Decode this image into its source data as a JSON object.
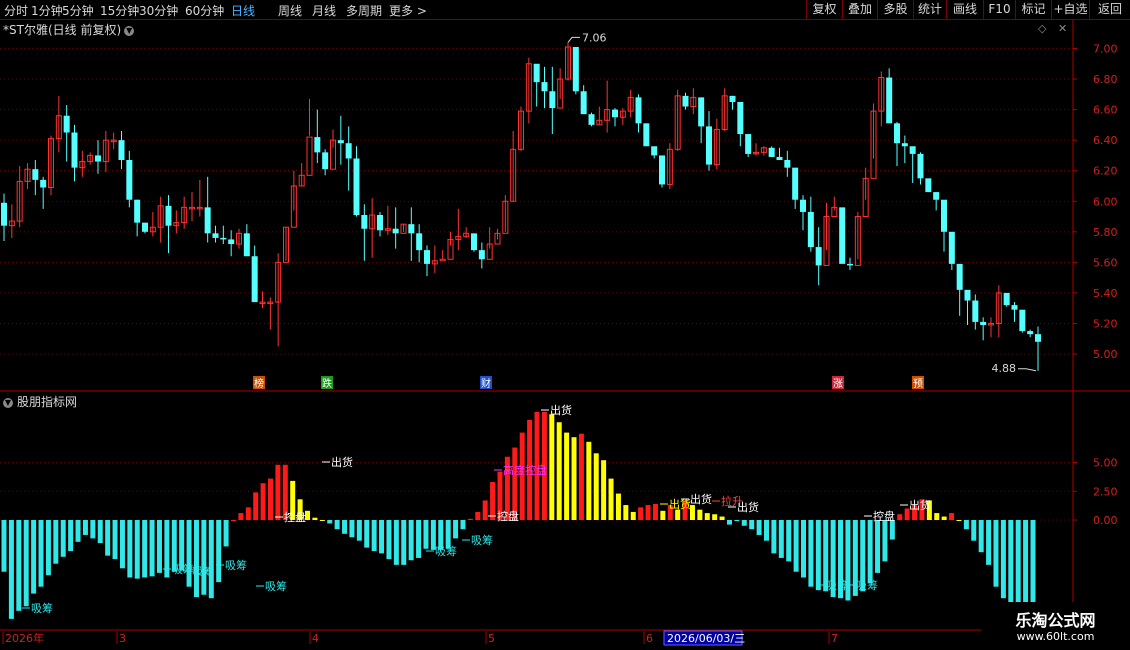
{
  "toolbar": {
    "periods": [
      {
        "label": "分时",
        "active": false
      },
      {
        "label": "1分钟",
        "active": false
      },
      {
        "label": "5分钟",
        "active": false
      },
      {
        "label": "15分钟",
        "active": false
      },
      {
        "label": "30分钟",
        "active": false
      },
      {
        "label": "60分钟",
        "active": false
      },
      {
        "label": "日线",
        "active": true
      },
      {
        "label": "周线",
        "active": false
      },
      {
        "label": "月线",
        "active": false
      },
      {
        "label": "多周期",
        "active": false
      },
      {
        "label": "更多 >",
        "active": false
      }
    ],
    "buttons": [
      "复权",
      "叠加",
      "多股",
      "统计",
      "画线",
      "F10",
      "标记",
      "+自选",
      "返回"
    ]
  },
  "main_chart": {
    "title": "*ST尔雅(日线 前复权)",
    "collapse_icon": "chevron-down-icon",
    "top_right_icons": [
      "diamond-icon",
      "close-icon"
    ],
    "high_label": "7.06",
    "low_label": "4.88",
    "event_markers": [
      {
        "text": "榜",
        "color": "#c85000"
      },
      {
        "text": "跌",
        "color": "#1a9a1a"
      },
      {
        "text": "财",
        "color": "#2050c8"
      },
      {
        "text": "涨",
        "color": "#c8283c"
      },
      {
        "text": "预",
        "color": "#c85000"
      }
    ]
  },
  "indicator": {
    "title": "股朋指标网",
    "collapse_icon": "chevron-down-icon",
    "labels": [
      "吸筹",
      "吸筹",
      "吸筹",
      "吸筹",
      "吸筹",
      "控盘",
      "出货",
      "吸筹",
      "吸筹",
      "控盘",
      "高度控盘",
      "出货",
      "出货",
      "出货",
      "拉升",
      "出货",
      "吸筹",
      "吸筹",
      "控盘",
      "出货"
    ]
  },
  "date_axis": {
    "labels": [
      "2026年",
      "3",
      "4",
      "5",
      "6",
      "7"
    ],
    "cursor_date": "2026/06/03/三"
  },
  "watermark": {
    "name": "乐淘公式网",
    "url": "www.60lt.com"
  },
  "chart_data": [
    {
      "type": "candlestick",
      "title": "*ST尔雅(日线 前复权)",
      "ylim": [
        4.85,
        7.15
      ],
      "yticks": [
        "7.00",
        "6.80",
        "6.60",
        "6.40",
        "6.20",
        "6.00",
        "5.80",
        "5.60",
        "5.40",
        "5.20",
        "5.00"
      ],
      "grid": true,
      "colors": {
        "up": "#ff3232",
        "down": "#54ffff"
      },
      "candles": [
        [
          5.99,
          5.84,
          6.05,
          5.74
        ],
        [
          5.84,
          5.87,
          5.98,
          5.76
        ],
        [
          5.87,
          6.13,
          6.23,
          5.83
        ],
        [
          6.13,
          6.21,
          6.25,
          6.08
        ],
        [
          6.21,
          6.14,
          6.27,
          6.04
        ],
        [
          6.14,
          6.09,
          6.16,
          5.95
        ],
        [
          6.09,
          6.41,
          6.43,
          6.04
        ],
        [
          6.41,
          6.56,
          6.69,
          6.32
        ],
        [
          6.56,
          6.45,
          6.63,
          6.26
        ],
        [
          6.45,
          6.22,
          6.5,
          6.13
        ],
        [
          6.22,
          6.26,
          6.33,
          6.16
        ],
        [
          6.26,
          6.3,
          6.32,
          6.24
        ],
        [
          6.3,
          6.26,
          6.4,
          6.18
        ],
        [
          6.26,
          6.4,
          6.46,
          6.19
        ],
        [
          6.4,
          6.4,
          6.45,
          6.34
        ],
        [
          6.4,
          6.27,
          6.46,
          6.21
        ],
        [
          6.27,
          6.01,
          6.33,
          5.96
        ],
        [
          6.01,
          5.86,
          6.01,
          5.77
        ],
        [
          5.86,
          5.8,
          5.84,
          5.79
        ],
        [
          5.8,
          5.83,
          5.93,
          5.77
        ],
        [
          5.83,
          5.97,
          6.03,
          5.73
        ],
        [
          5.97,
          5.84,
          6.04,
          5.66
        ],
        [
          5.84,
          5.86,
          5.94,
          5.79
        ],
        [
          5.86,
          5.96,
          6.03,
          5.82
        ],
        [
          5.96,
          5.96,
          6.06,
          5.87
        ],
        [
          5.96,
          5.96,
          6.14,
          5.9
        ],
        [
          5.96,
          5.79,
          6.16,
          5.73
        ],
        [
          5.79,
          5.76,
          5.84,
          5.73
        ],
        [
          5.76,
          5.75,
          5.84,
          5.72
        ],
        [
          5.75,
          5.72,
          5.81,
          5.64
        ],
        [
          5.72,
          5.79,
          5.82,
          5.69
        ],
        [
          5.79,
          5.64,
          5.85,
          5.65
        ],
        [
          5.64,
          5.34,
          5.71,
          5.37
        ],
        [
          5.34,
          5.34,
          5.41,
          5.3
        ],
        [
          5.34,
          5.34,
          5.37,
          5.16
        ],
        [
          5.34,
          5.6,
          5.66,
          5.05
        ],
        [
          5.6,
          5.83,
          5.83,
          5.61
        ],
        [
          5.83,
          6.1,
          6.2,
          5.94
        ],
        [
          6.1,
          6.17,
          6.25,
          6.1
        ],
        [
          6.17,
          6.42,
          6.67,
          6.43
        ],
        [
          6.42,
          6.32,
          6.6,
          6.25
        ],
        [
          6.32,
          6.21,
          6.34,
          6.17
        ],
        [
          6.21,
          6.4,
          6.47,
          6.35
        ],
        [
          6.4,
          6.38,
          6.56,
          6.24
        ],
        [
          6.38,
          6.28,
          6.49,
          6.07
        ],
        [
          6.28,
          5.91,
          6.36,
          5.9
        ],
        [
          5.91,
          5.82,
          5.98,
          5.61
        ],
        [
          5.82,
          5.91,
          6.02,
          5.63
        ],
        [
          5.91,
          5.81,
          5.93,
          5.77
        ],
        [
          5.81,
          5.82,
          5.97,
          5.78
        ],
        [
          5.82,
          5.79,
          5.96,
          5.69
        ],
        [
          5.79,
          5.85,
          5.85,
          5.8
        ],
        [
          5.85,
          5.79,
          5.96,
          5.61
        ],
        [
          5.79,
          5.68,
          5.85,
          5.6
        ],
        [
          5.68,
          5.59,
          5.71,
          5.51
        ],
        [
          5.59,
          5.61,
          5.71,
          5.53
        ],
        [
          5.61,
          5.62,
          5.68,
          5.62
        ],
        [
          5.62,
          5.75,
          5.8,
          5.71
        ],
        [
          5.75,
          5.77,
          5.95,
          5.68
        ],
        [
          5.77,
          5.79,
          5.83,
          5.76
        ],
        [
          5.79,
          5.68,
          5.77,
          5.67
        ],
        [
          5.68,
          5.62,
          5.73,
          5.56
        ],
        [
          5.62,
          5.72,
          5.83,
          5.69
        ],
        [
          5.72,
          5.79,
          5.82,
          5.75
        ],
        [
          5.79,
          6.0,
          6.04,
          5.8
        ],
        [
          6.0,
          6.34,
          6.46,
          6.0
        ],
        [
          6.34,
          6.59,
          6.62,
          6.33
        ],
        [
          6.59,
          6.9,
          6.94,
          6.51
        ],
        [
          6.9,
          6.78,
          6.89,
          6.62
        ],
        [
          6.78,
          6.72,
          6.88,
          6.61
        ],
        [
          6.72,
          6.61,
          6.88,
          6.44
        ],
        [
          6.61,
          6.8,
          6.87,
          6.67
        ],
        [
          6.8,
          7.01,
          7.04,
          6.79
        ],
        [
          7.01,
          6.72,
          6.93,
          6.7
        ],
        [
          6.72,
          6.57,
          6.76,
          6.62
        ],
        [
          6.57,
          6.5,
          6.58,
          6.49
        ],
        [
          6.5,
          6.53,
          6.62,
          6.5
        ],
        [
          6.53,
          6.6,
          6.79,
          6.45
        ],
        [
          6.6,
          6.55,
          6.61,
          6.49
        ],
        [
          6.55,
          6.59,
          6.61,
          6.5
        ],
        [
          6.59,
          6.68,
          6.73,
          6.55
        ],
        [
          6.68,
          6.51,
          6.7,
          6.45
        ],
        [
          6.51,
          6.36,
          6.51,
          6.38
        ],
        [
          6.36,
          6.3,
          6.35,
          6.28
        ],
        [
          6.3,
          6.11,
          6.21,
          6.09
        ],
        [
          6.11,
          6.34,
          6.38,
          6.08
        ],
        [
          6.34,
          6.69,
          6.73,
          6.33
        ],
        [
          6.69,
          6.62,
          6.71,
          6.6
        ],
        [
          6.62,
          6.68,
          6.74,
          6.57
        ],
        [
          6.68,
          6.49,
          6.67,
          6.38
        ],
        [
          6.49,
          6.24,
          6.59,
          6.2
        ],
        [
          6.24,
          6.47,
          6.54,
          6.21
        ],
        [
          6.47,
          6.69,
          6.74,
          6.46
        ],
        [
          6.69,
          6.65,
          6.69,
          6.6
        ],
        [
          6.65,
          6.44,
          6.61,
          6.36
        ],
        [
          6.44,
          6.31,
          6.35,
          6.29
        ],
        [
          6.31,
          6.32,
          6.38,
          6.3
        ],
        [
          6.32,
          6.35,
          6.36,
          6.3
        ],
        [
          6.35,
          6.29,
          6.36,
          6.29
        ],
        [
          6.29,
          6.27,
          6.35,
          6.28
        ],
        [
          6.27,
          6.22,
          6.33,
          6.16
        ],
        [
          6.22,
          6.01,
          6.15,
          5.95
        ],
        [
          6.01,
          5.93,
          6.04,
          5.81
        ],
        [
          5.93,
          5.7,
          6.03,
          5.67
        ],
        [
          5.7,
          5.58,
          5.83,
          5.45
        ],
        [
          5.58,
          5.9,
          5.99,
          5.68
        ],
        [
          5.9,
          5.96,
          6.03,
          5.94
        ],
        [
          5.96,
          5.59,
          5.92,
          5.61
        ],
        [
          5.59,
          5.58,
          5.63,
          5.55
        ],
        [
          5.58,
          5.9,
          5.93,
          5.62
        ],
        [
          5.9,
          6.15,
          6.22,
          6.01
        ],
        [
          6.15,
          6.59,
          6.64,
          6.28
        ],
        [
          6.59,
          6.81,
          6.85,
          6.49
        ],
        [
          6.81,
          6.51,
          6.87,
          6.52
        ],
        [
          6.51,
          6.38,
          6.52,
          6.23
        ],
        [
          6.38,
          6.36,
          6.43,
          6.25
        ],
        [
          6.36,
          6.31,
          6.35,
          6.12
        ],
        [
          6.31,
          6.15,
          6.32,
          6.11
        ],
        [
          6.15,
          6.06,
          6.12,
          6.06
        ],
        [
          6.06,
          6.01,
          6.04,
          5.94
        ],
        [
          6.01,
          5.8,
          5.96,
          5.67
        ],
        [
          5.8,
          5.59,
          5.76,
          5.55
        ],
        [
          5.59,
          5.42,
          5.47,
          5.25
        ],
        [
          5.42,
          5.35,
          5.39,
          5.19
        ],
        [
          5.35,
          5.21,
          5.39,
          5.16
        ],
        [
          5.21,
          5.19,
          5.24,
          5.09
        ],
        [
          5.19,
          5.2,
          5.24,
          5.11
        ],
        [
          5.2,
          5.4,
          5.45,
          5.11
        ],
        [
          5.4,
          5.32,
          5.39,
          5.31
        ],
        [
          5.32,
          5.29,
          5.34,
          5.21
        ],
        [
          5.29,
          5.15,
          5.27,
          5.14
        ],
        [
          5.15,
          5.13,
          5.16,
          5.11
        ],
        [
          5.13,
          5.08,
          5.18,
          4.89
        ]
      ]
    },
    {
      "type": "bar",
      "title": "股朋指标网",
      "ylim": [
        -9.5,
        9.9
      ],
      "yticks": [
        "5.00",
        "2.50",
        "0.00"
      ],
      "grid": true,
      "values": [
        -4.5,
        -8.6,
        -7.9,
        -7.5,
        -6.4,
        -5.8,
        -4.8,
        -3.8,
        -3.2,
        -2.7,
        -1.9,
        -1.3,
        -1.6,
        -2.0,
        -3.1,
        -3.4,
        -4.2,
        -5.0,
        -5.1,
        -5.0,
        -4.9,
        -4.6,
        -5.0,
        -4.5,
        -4.4,
        -5.8,
        -6.7,
        -6.5,
        -6.8,
        -5.4,
        -2.3,
        0.0,
        0.6,
        1.1,
        2.4,
        3.2,
        3.6,
        4.8,
        4.8,
        3.4,
        1.8,
        0.8,
        0.2,
        0.0,
        -0.3,
        -0.8,
        -1.2,
        -1.5,
        -1.8,
        -2.4,
        -2.7,
        -2.9,
        -3.4,
        -3.9,
        -3.9,
        -3.5,
        -3.3,
        -2.5,
        -2.6,
        -2.6,
        -2.5,
        -1.6,
        -0.8,
        0.1,
        0.7,
        1.7,
        3.3,
        4.2,
        5.5,
        6.3,
        7.6,
        8.7,
        9.4,
        9.4,
        9.2,
        8.5,
        7.6,
        7.2,
        7.5,
        6.8,
        5.8,
        5.2,
        3.6,
        2.3,
        1.3,
        0.7,
        1.1,
        1.3,
        1.4,
        0.8,
        1.3,
        0.9,
        1.7,
        1.3,
        0.9,
        0.6,
        0.5,
        0.3,
        -0.4,
        -0.1,
        -0.5,
        -0.8,
        -1.3,
        -1.8,
        -2.9,
        -3.3,
        -3.6,
        -4.5,
        -5.0,
        -5.8,
        -6.1,
        -6.2,
        -6.7,
        -6.8,
        -7.0,
        -6.6,
        -6.2,
        -5.5,
        -4.6,
        -3.6,
        -1.7,
        0.5,
        1.0,
        1.3,
        1.8,
        1.7,
        0.6,
        0.3,
        0.6,
        0.0,
        -0.8,
        -1.8,
        -2.8,
        -3.9,
        -5.8,
        -6.8,
        -7.5,
        -8.6,
        -9.3,
        -9.7
      ],
      "colors": {
        "negative": "#30e8e8",
        "rising": "#ff1a1a",
        "falling": "#ffff00"
      }
    }
  ]
}
